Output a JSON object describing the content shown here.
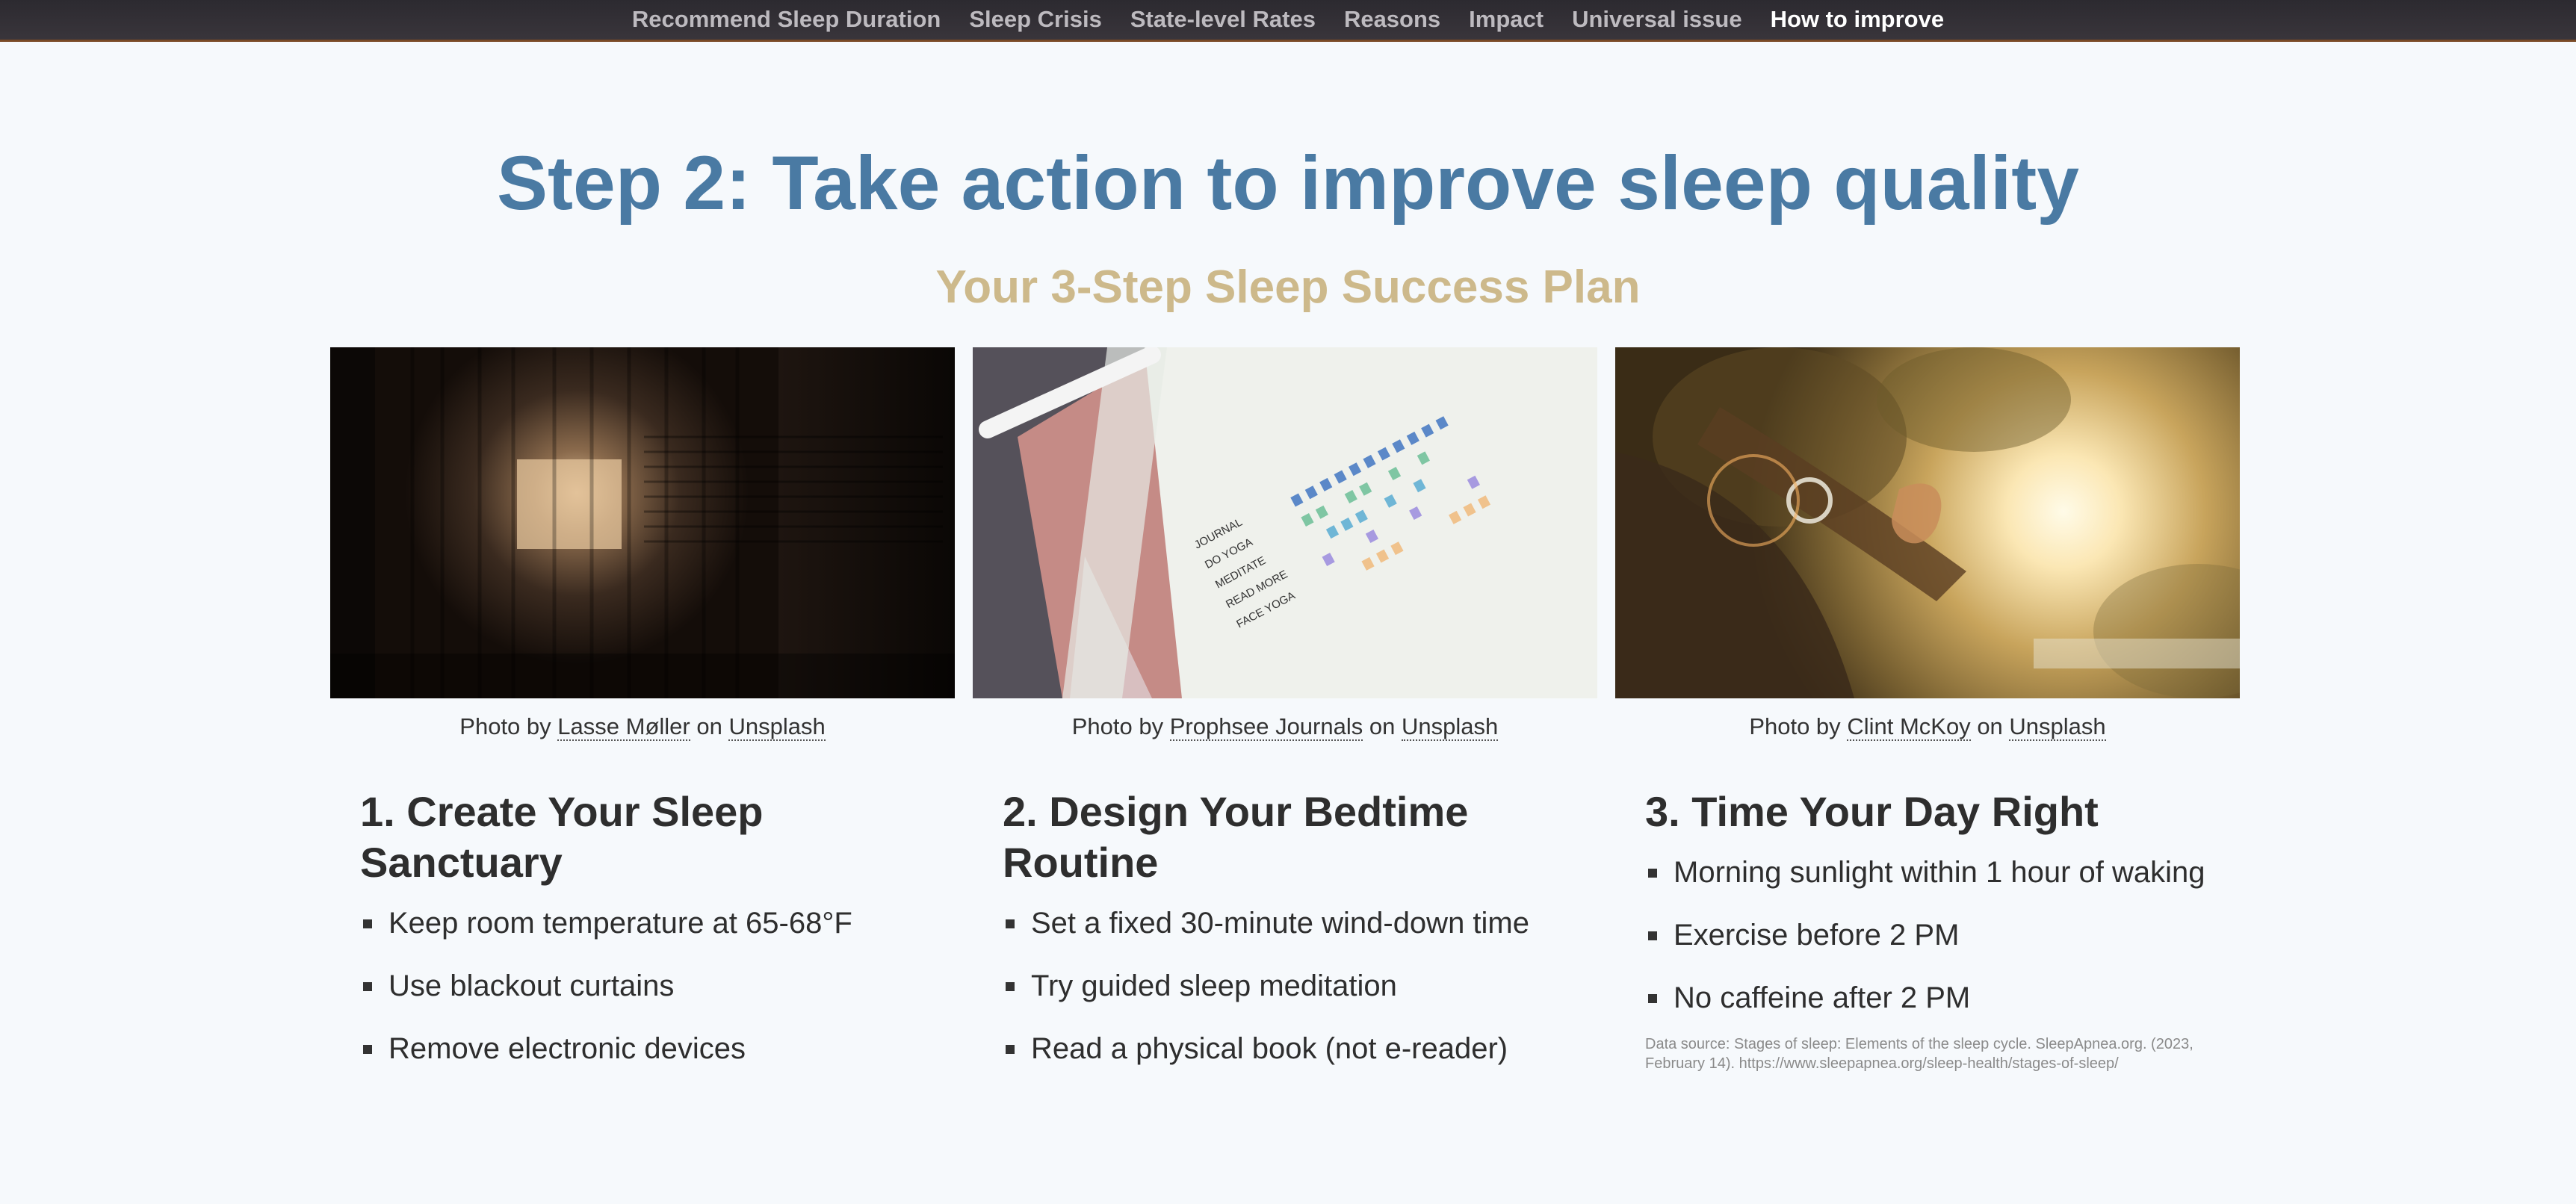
{
  "nav": {
    "items": [
      {
        "label": "Recommend Sleep Duration",
        "active": false
      },
      {
        "label": "Sleep Crisis",
        "active": false
      },
      {
        "label": "State-level Rates",
        "active": false
      },
      {
        "label": "Reasons",
        "active": false
      },
      {
        "label": "Impact",
        "active": false
      },
      {
        "label": "Universal issue",
        "active": false
      },
      {
        "label": "How to improve",
        "active": true
      }
    ]
  },
  "header": {
    "title": "Step 2: Take action to improve sleep quality",
    "subtitle": "Your 3-Step Sleep Success Plan"
  },
  "steps": [
    {
      "photo_caption_prefix": "Photo by",
      "photographer": "Lasse Møller",
      "caption_on": "on",
      "source_site": "Unsplash",
      "title": "1. Create Your Sleep Sanctuary",
      "items": [
        "Keep room temperature at 65-68°F",
        "Use blackout curtains",
        "Remove electronic devices"
      ]
    },
    {
      "photo_caption_prefix": "Photo by",
      "photographer": "Prophsee Journals",
      "caption_on": "on",
      "source_site": "Unsplash",
      "title": "2. Design Your Bedtime Routine",
      "journal_labels": [
        "JOURNAL",
        "DO YOGA",
        "MEDITATE",
        "READ MORE",
        "FACE YOGA"
      ],
      "items": [
        "Set a fixed 30-minute wind-down time",
        "Try guided sleep meditation",
        "Read a physical book (not e-reader)"
      ]
    },
    {
      "photo_caption_prefix": "Photo by",
      "photographer": "Clint McKoy",
      "caption_on": "on",
      "source_site": "Unsplash",
      "title": "3. Time Your Day Right",
      "items": [
        "Morning sunlight within 1 hour of waking",
        "Exercise before 2 PM",
        "No caffeine after 2 PM"
      ]
    }
  ],
  "data_source": "Data source: Stages of sleep: Elements of the sleep cycle. SleepApnea.org. (2023, February 14). https://www.sleepapnea.org/sleep-health/stages-of-sleep/"
}
